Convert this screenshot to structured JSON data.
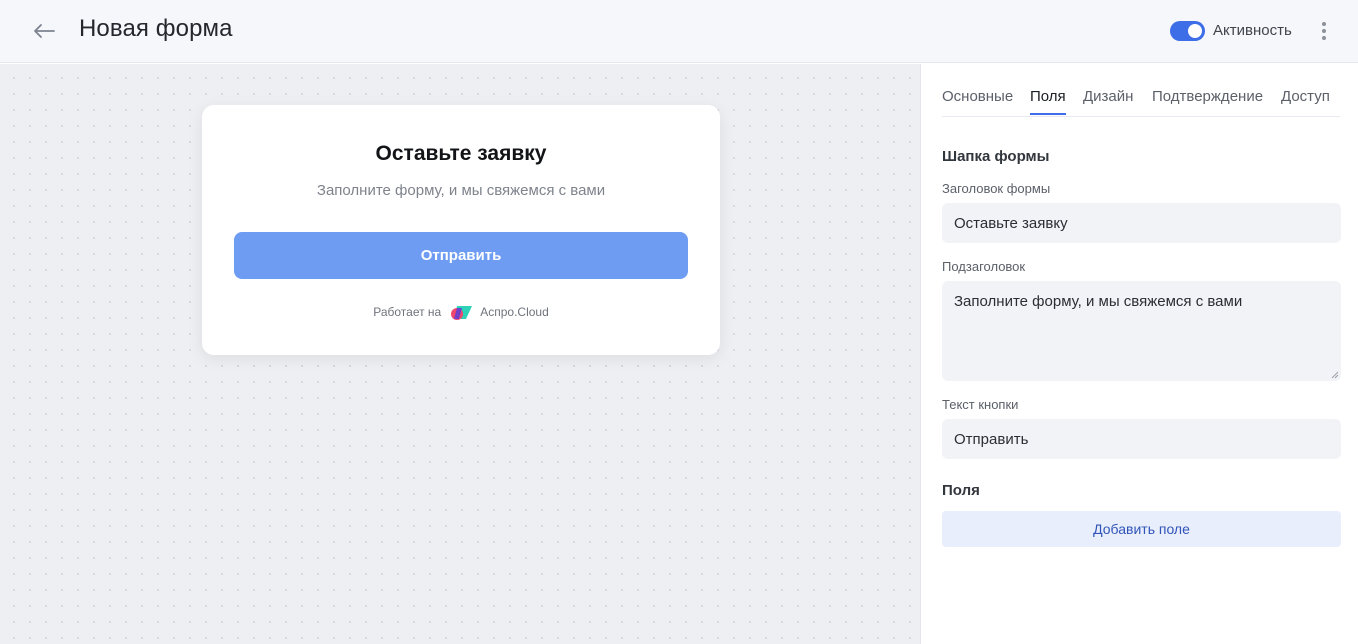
{
  "header": {
    "title": "Новая форма",
    "active_label": "Активность",
    "active": true
  },
  "preview": {
    "title": "Оставьте заявку",
    "subtitle": "Заполните форму, и мы свяжемся с вами",
    "button_label": "Отправить",
    "powered_prefix": "Работает на",
    "powered_brand": "Аспро.Cloud"
  },
  "panel": {
    "tabs": [
      {
        "label": "Основные",
        "active": false
      },
      {
        "label": "Поля",
        "active": true
      },
      {
        "label": "Дизайн",
        "active": false
      },
      {
        "label": "Подтверждение",
        "active": false
      },
      {
        "label": "Доступ",
        "active": false
      }
    ],
    "header_section_title": "Шапка формы",
    "form_title_label": "Заголовок формы",
    "form_title_value": "Оставьте заявку",
    "subtitle_label": "Подзаголовок",
    "subtitle_value": "Заполните форму, и мы свяжемся с вами",
    "button_text_label": "Текст кнопки",
    "button_text_value": "Отправить",
    "fields_section_title": "Поля",
    "add_field_label": "Добавить поле"
  },
  "colors": {
    "accent": "#3d6ee8",
    "button": "#6d9cf2",
    "canvas_bg": "#eeeff2"
  }
}
